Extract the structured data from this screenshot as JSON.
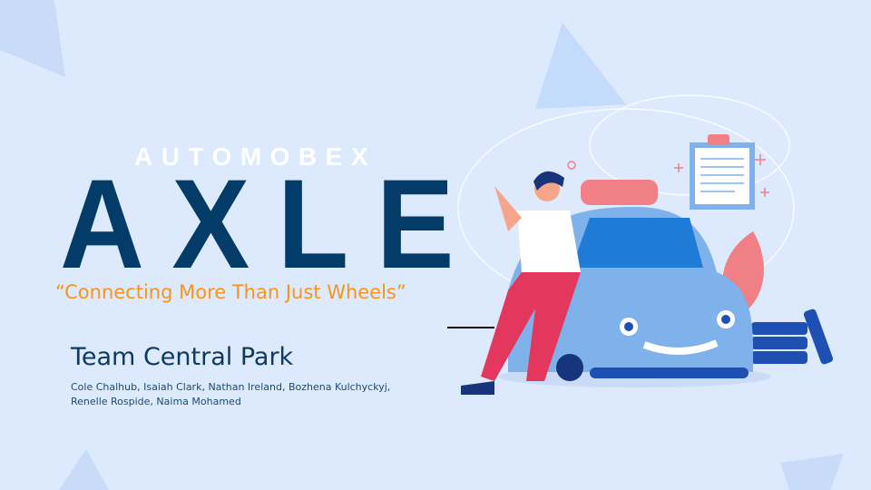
{
  "slide": {
    "brand": "AUTOMOBEX",
    "title": "AXLE",
    "tagline": "“Connecting More Than Just Wheels”",
    "team_name": "Team Central Park",
    "members_line1": "Cole Chalhub, Isaiah Clark, Nathan Ireland, Bozhena Kulchyckyj,",
    "members_line2": "Renelle Rospide, Naima Mohamed"
  },
  "colors": {
    "background": "#dde9fc",
    "title": "#033b69",
    "tagline": "#f7941d",
    "car": "#7fb2ea",
    "accent": "#f07f86"
  }
}
